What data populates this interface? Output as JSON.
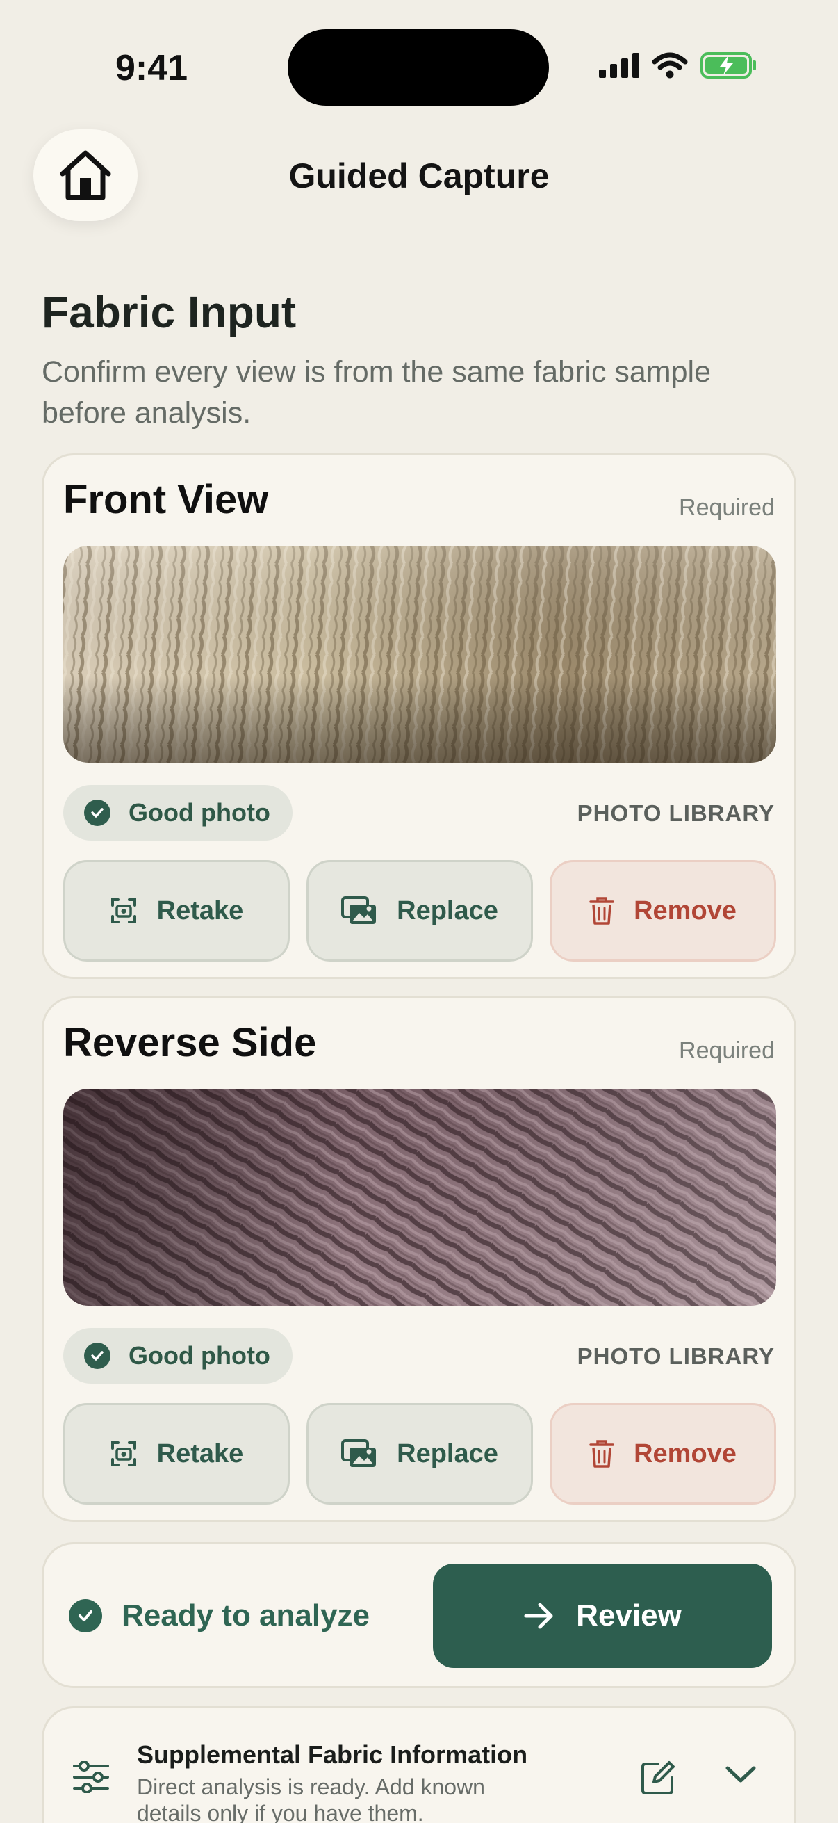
{
  "status": {
    "time": "9:41"
  },
  "header": {
    "title": "Guided Capture",
    "home_icon": "house-icon"
  },
  "section": {
    "title": "Fabric Input",
    "subtitle": "Confirm every view is from the same fabric sample before analysis."
  },
  "cards": [
    {
      "title": "Front View",
      "requirement": "Required",
      "quality": "Good photo",
      "source": "PHOTO LIBRARY",
      "actions": {
        "retake": "Retake",
        "replace": "Replace",
        "remove": "Remove"
      }
    },
    {
      "title": "Reverse Side",
      "requirement": "Required",
      "quality": "Good photo",
      "source": "PHOTO LIBRARY",
      "actions": {
        "retake": "Retake",
        "replace": "Replace",
        "remove": "Remove"
      }
    }
  ],
  "ready": {
    "label": "Ready to analyze",
    "button": "Review"
  },
  "supplemental": {
    "title": "Supplemental Fabric Information",
    "description": "Direct analysis is ready. Add known details only if you have them."
  },
  "colors": {
    "background": "#f1eee6",
    "accent": "#2d5e4f",
    "danger": "#b14636"
  }
}
